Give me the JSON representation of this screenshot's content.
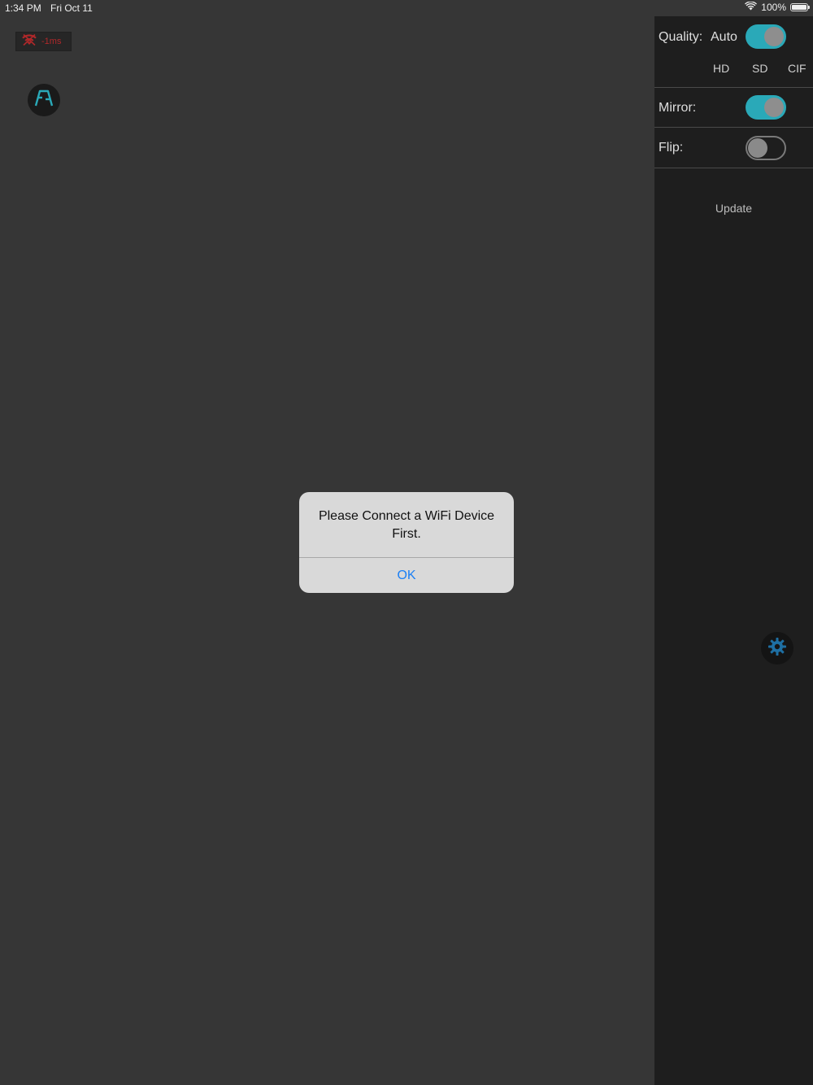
{
  "status_bar": {
    "time": "1:34 PM",
    "date": "Fri Oct 11",
    "battery": "100%"
  },
  "latency_badge": {
    "text": "-1ms",
    "icon": "no-wifi-signal-icon",
    "color": "#b0282a"
  },
  "logo_button": {
    "icon": "fa-logo-icon",
    "color": "#2aa9b8"
  },
  "side_panel": {
    "quality": {
      "label": "Quality:",
      "value": "Auto",
      "toggle_on": true,
      "options": [
        "HD",
        "SD",
        "CIF"
      ]
    },
    "mirror": {
      "label": "Mirror:",
      "toggle_on": true
    },
    "flip": {
      "label": "Flip:",
      "toggle_on": false
    },
    "update_label": "Update"
  },
  "settings_button": {
    "icon": "gear-icon",
    "color": "#1e6fa3"
  },
  "alert": {
    "message": "Please Connect a WiFi Device First.",
    "ok_label": "OK",
    "accent": "#1a7ff5"
  }
}
